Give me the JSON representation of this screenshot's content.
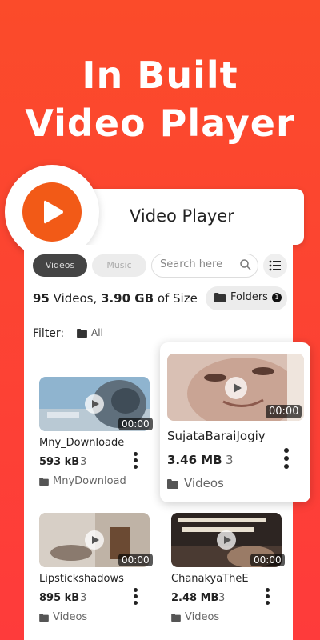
{
  "promo": {
    "headline_line1": "In  Built",
    "headline_line2": "Video Player"
  },
  "header": {
    "title": "Video Player",
    "logo_icon": "play-icon",
    "brand_color": "#f25a17"
  },
  "tabs": [
    {
      "label": "Videos",
      "active": true
    },
    {
      "label": "Music",
      "active": false
    }
  ],
  "search": {
    "placeholder": "Search here",
    "icon": "search-icon"
  },
  "toolbar": {
    "view_icon": "list-icon"
  },
  "summary": {
    "count": "95",
    "count_label": "Videos,",
    "size": "3.90 GB",
    "size_label": "of Size"
  },
  "folders_button": {
    "label": "Folders",
    "badge": "1",
    "icon": "folder-icon"
  },
  "filter": {
    "label": "Filter:",
    "value": "All"
  },
  "videos": [
    {
      "name": "Mny_Downloade",
      "duration": "00:00",
      "size": "593 kB",
      "count": "3",
      "folder": "MnyDownload"
    },
    {
      "name": "SujataBaraiJogiy",
      "duration": "00:00",
      "size": "3.46 MB",
      "count": "3",
      "folder": "Videos"
    },
    {
      "name": "Lipstickshadows",
      "duration": "00:00",
      "size": "895 kB",
      "count": "3",
      "folder": "Videos"
    },
    {
      "name": "ChanakyaTheE",
      "duration": "00:00",
      "size": "2.48 MB",
      "count": "3",
      "folder": "Videos"
    }
  ]
}
